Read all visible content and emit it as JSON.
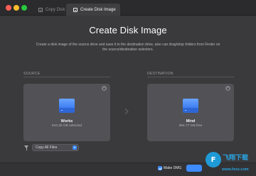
{
  "tabs": [
    {
      "label": "Copy Disk"
    },
    {
      "label": "Create Disk Image"
    }
  ],
  "header": {
    "title": "Create Disk Image",
    "description": "Create a disk image of the source drive and save it to the destination drive, also can drag/drop folders from Finder on the source/destination selectors."
  },
  "source": {
    "section_label": "SOURCE",
    "drive_name": "Works",
    "drive_info": "944.25 GB selected"
  },
  "destination": {
    "section_label": "DESTINATION",
    "drive_name": "Mind",
    "drive_info": "994.77 GB free"
  },
  "filter": {
    "selected": "Copy All Files"
  },
  "footer": {
    "make_dmg_label": "Make DMG",
    "make_dmg_checked": true
  },
  "watermark": {
    "logo_text": "F",
    "name": "飞翔下载",
    "url": "www.fxxz.com"
  },
  "colors": {
    "accent": "#3e8bff",
    "drive": "#3d7df2"
  }
}
